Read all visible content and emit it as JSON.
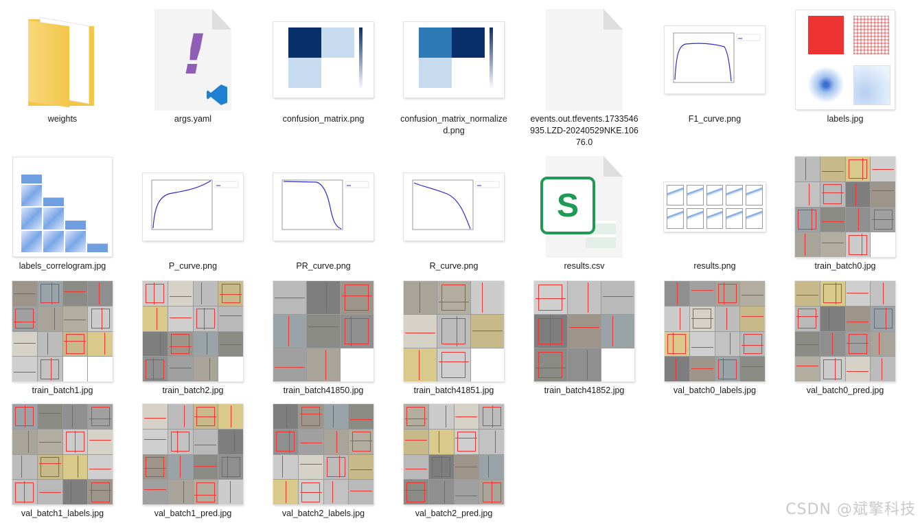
{
  "files": [
    {
      "name": "weights",
      "type": "folder"
    },
    {
      "name": "args.yaml",
      "type": "yaml"
    },
    {
      "name": "confusion_matrix.png",
      "type": "cm"
    },
    {
      "name": "confusion_matrix_normalized.png",
      "type": "cmn"
    },
    {
      "name": "events.out.tfevents.1733546935.LZD-20240529NKE.10676.0",
      "type": "blank"
    },
    {
      "name": "F1_curve.png",
      "type": "f1"
    },
    {
      "name": "labels.jpg",
      "type": "labels"
    },
    {
      "name": "labels_correlogram.jpg",
      "type": "correlogram"
    },
    {
      "name": "P_curve.png",
      "type": "p"
    },
    {
      "name": "PR_curve.png",
      "type": "pr"
    },
    {
      "name": "R_curve.png",
      "type": "r"
    },
    {
      "name": "results.csv",
      "type": "csv"
    },
    {
      "name": "results.png",
      "type": "results"
    },
    {
      "name": "train_batch0.jpg",
      "type": "batch"
    },
    {
      "name": "train_batch1.jpg",
      "type": "batch"
    },
    {
      "name": "train_batch2.jpg",
      "type": "batch"
    },
    {
      "name": "train_batch41850.jpg",
      "type": "batch"
    },
    {
      "name": "train_batch41851.jpg",
      "type": "batch"
    },
    {
      "name": "train_batch41852.jpg",
      "type": "batch"
    },
    {
      "name": "val_batch0_labels.jpg",
      "type": "val"
    },
    {
      "name": "val_batch0_pred.jpg",
      "type": "val"
    },
    {
      "name": "val_batch1_labels.jpg",
      "type": "val"
    },
    {
      "name": "val_batch1_pred.jpg",
      "type": "val"
    },
    {
      "name": "val_batch2_labels.jpg",
      "type": "val"
    },
    {
      "name": "val_batch2_pred.jpg",
      "type": "val"
    }
  ],
  "icons": {
    "folder_color": "#f3c64a",
    "yaml_mark": "!",
    "yaml_mark_color": "#8f5fb8",
    "vscode_color": "#1f7fd0",
    "csv_letter": "S",
    "csv_color": "#1e9a55"
  },
  "colors": {
    "crack": "#ee3333",
    "cm_dark": "#08306b",
    "cm_light": "#c6dbef",
    "curve": "#2b2bd1"
  },
  "watermark": "CSDN @斌擎科技"
}
